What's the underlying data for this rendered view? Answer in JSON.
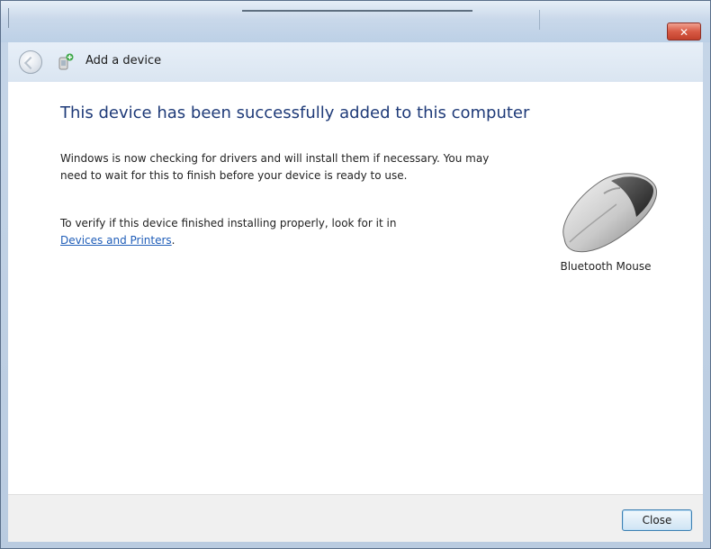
{
  "window": {
    "close_glyph": "✕"
  },
  "nav": {
    "title": "Add a device"
  },
  "content": {
    "heading": "This device has been successfully added to this computer",
    "paragraph1": "Windows is now checking for drivers and will install them if necessary. You may need to wait for this to finish before your device is ready to use.",
    "paragraph2_prefix": "To verify if this device finished installing properly, look for it in",
    "paragraph2_link": "Devices and Printers",
    "paragraph2_suffix": "."
  },
  "device": {
    "label": "Bluetooth Mouse",
    "icon": "mouse-icon"
  },
  "footer": {
    "close_label": "Close"
  },
  "colors": {
    "heading": "#1e3a78",
    "link": "#1f5db8",
    "close_button_border": "#3c7fb1",
    "titlebar_close": "#d85a45"
  }
}
